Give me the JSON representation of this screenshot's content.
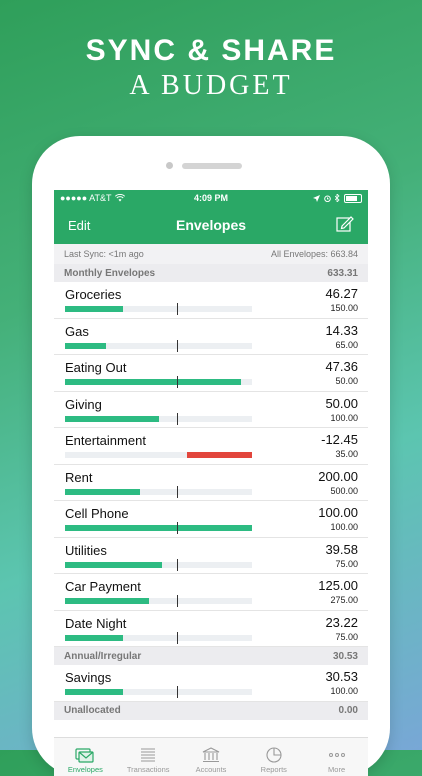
{
  "headline": {
    "line1": "SYNC & SHARE",
    "line2": "A BUDGET"
  },
  "status_bar": {
    "carrier": "●●●●● AT&T",
    "time": "4:09 PM"
  },
  "nav": {
    "edit_label": "Edit",
    "title": "Envelopes"
  },
  "sync": {
    "last_sync": "Last Sync: <1m ago",
    "all_envelopes": "All Envelopes: 663.84"
  },
  "monthly": {
    "label": "Monthly Envelopes",
    "total": "633.31",
    "items": [
      {
        "name": "Groceries",
        "amount": "46.27",
        "budget": "150.00",
        "progress": 0.31,
        "negative": false
      },
      {
        "name": "Gas",
        "amount": "14.33",
        "budget": "65.00",
        "progress": 0.22,
        "negative": false
      },
      {
        "name": "Eating Out",
        "amount": "47.36",
        "budget": "50.00",
        "progress": 0.94,
        "negative": false
      },
      {
        "name": "Giving",
        "amount": "50.00",
        "budget": "100.00",
        "progress": 0.5,
        "negative": false
      },
      {
        "name": "Entertainment",
        "amount": "-12.45",
        "budget": "35.00",
        "progress": 0.35,
        "negative": true
      },
      {
        "name": "Rent",
        "amount": "200.00",
        "budget": "500.00",
        "progress": 0.4,
        "negative": false
      },
      {
        "name": "Cell Phone",
        "amount": "100.00",
        "budget": "100.00",
        "progress": 1.0,
        "negative": false
      },
      {
        "name": "Utilities",
        "amount": "39.58",
        "budget": "75.00",
        "progress": 0.52,
        "negative": false
      },
      {
        "name": "Car Payment",
        "amount": "125.00",
        "budget": "275.00",
        "progress": 0.45,
        "negative": false
      },
      {
        "name": "Date Night",
        "amount": "23.22",
        "budget": "75.00",
        "progress": 0.31,
        "negative": false
      }
    ]
  },
  "annual": {
    "label": "Annual/Irregular",
    "total": "30.53",
    "items": [
      {
        "name": "Savings",
        "amount": "30.53",
        "budget": "100.00",
        "progress": 0.31,
        "negative": false
      }
    ]
  },
  "unallocated": {
    "label": "Unallocated",
    "total": "0.00"
  },
  "tabs": [
    {
      "label": "Envelopes",
      "icon": "envelopes-icon",
      "active": true
    },
    {
      "label": "Transactions",
      "icon": "list-icon",
      "active": false
    },
    {
      "label": "Accounts",
      "icon": "bank-icon",
      "active": false
    },
    {
      "label": "Reports",
      "icon": "pie-chart-icon",
      "active": false
    },
    {
      "label": "More",
      "icon": "more-icon",
      "active": false
    }
  ],
  "colors": {
    "brand": "#2aa866",
    "progress": "#2dbb82",
    "overspent": "#e2453c"
  }
}
